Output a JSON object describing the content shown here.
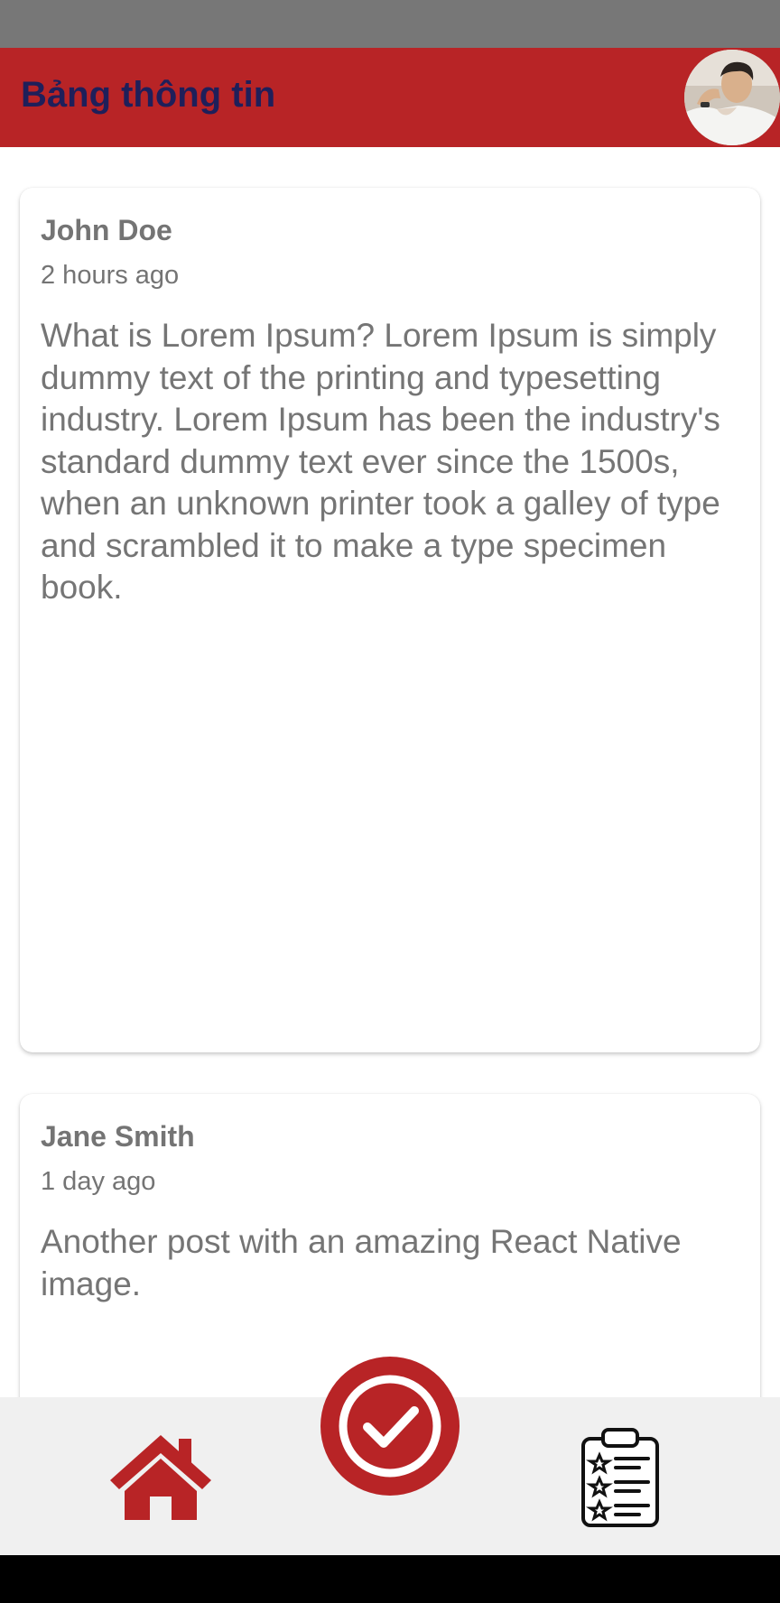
{
  "app": {
    "title": "Bảng thông tin",
    "colors": {
      "primary": "#b82426",
      "title_text": "#1f1f5a",
      "status_bar": "#777777",
      "bottom_bar": "#f0f0f0",
      "post_text": "#757575"
    }
  },
  "header": {
    "title": "Bảng thông tin",
    "avatar_icon": "user-avatar-photo"
  },
  "posts": [
    {
      "author": "John Doe",
      "time": "2 hours ago",
      "content": "What is Lorem Ipsum? Lorem Ipsum is simply dummy text of the printing and typesetting industry. Lorem Ipsum has been the industry's standard dummy text ever since the 1500s, when an unknown printer took a galley of type and scrambled it to make a type specimen book."
    },
    {
      "author": "Jane Smith",
      "time": "1 day ago",
      "content": "Another post with an amazing React Native image."
    }
  ],
  "bottom_nav": {
    "items": [
      {
        "icon": "home-icon"
      },
      {
        "icon": "check-circle-icon"
      },
      {
        "icon": "clipboard-list-icon"
      }
    ]
  }
}
